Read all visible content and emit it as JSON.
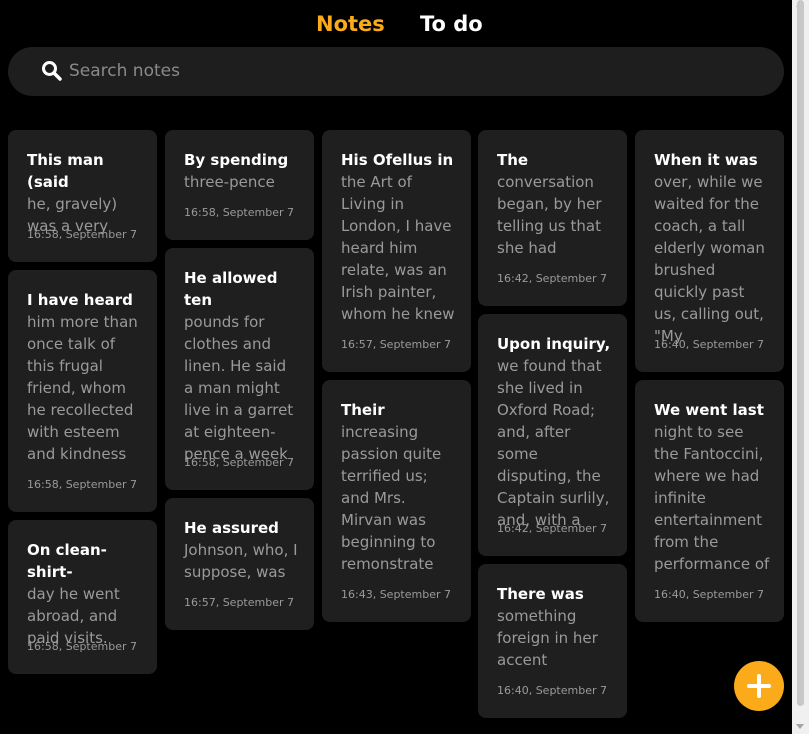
{
  "tabs": [
    {
      "label": "Notes",
      "active": true,
      "color": "#fbaa1a"
    },
    {
      "label": "To do",
      "active": false,
      "color": "#ffffff"
    }
  ],
  "search": {
    "placeholder": "Search notes",
    "icon": "search-icon"
  },
  "columns": [
    [
      {
        "title": "This man (said",
        "body": "he, gravely) was a very",
        "time": "16:58, September 7"
      },
      {
        "title": "I have heard",
        "body": "him more than once talk of this frugal friend, whom he recollected with esteem and kindness",
        "time": "16:58, September 7"
      },
      {
        "title": "On clean-shirt-",
        "body": "day he went abroad, and paid visits.",
        "time": "16:58, September 7"
      }
    ],
    [
      {
        "title": "By spending",
        "body": "three-pence",
        "time": "16:58, September 7"
      },
      {
        "title": "He allowed ten",
        "body": "pounds for clothes and linen. He said a man might live in a garret at eighteen-pence a week",
        "time": "16:58, September 7"
      },
      {
        "title": "He assured",
        "body": "Johnson, who, I suppose, was",
        "time": "16:57, September 7"
      }
    ],
    [
      {
        "title": "His Ofellus in",
        "body": "the Art of Living in London, I have heard him relate, was an Irish painter, whom he knew",
        "time": "16:57, September 7"
      },
      {
        "title": "Their",
        "body": "increasing passion quite terrified us; and Mrs. Mirvan was beginning to remonstrate",
        "time": "16:43, September 7"
      }
    ],
    [
      {
        "title": "The",
        "body": "conversation began, by her telling us that she had",
        "time": "16:42, September 7"
      },
      {
        "title": "Upon inquiry,",
        "body": "we found that she lived in Oxford Road; and, after some disputing, the Captain surlily, and, with a",
        "time": "16:42, September 7"
      },
      {
        "title": "There was",
        "body": "something foreign in her accent",
        "time": "16:40, September 7"
      }
    ],
    [
      {
        "title": "When it was",
        "body": "over, while we waited for the coach, a tall elderly woman brushed quickly past us, calling out, \"My",
        "time": "16:40, September 7"
      },
      {
        "title": "We went last",
        "body": "night to see the Fantoccini, where we had infinite entertainment from the performance of",
        "time": "16:40, September 7"
      }
    ]
  ],
  "fab": {
    "icon": "plus-icon",
    "color": "#fbaa1a"
  }
}
